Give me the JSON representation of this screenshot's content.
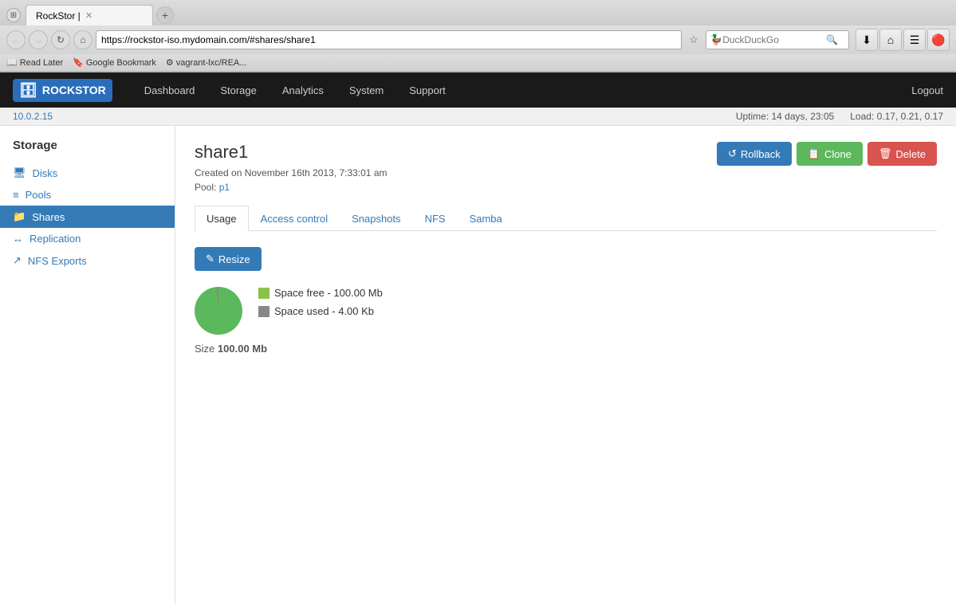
{
  "browser": {
    "tab_title": "RockStor |",
    "url": "https://rockstor-iso.mydomain.com/#shares/share1",
    "bookmarks": [
      {
        "label": "Read Later",
        "icon": "📖"
      },
      {
        "label": "Google Bookmark",
        "icon": "🔖"
      },
      {
        "label": "vagrant-lxc/REA...",
        "icon": "⚙"
      }
    ]
  },
  "app": {
    "logo": "ROCKSTOR",
    "nav": [
      "Dashboard",
      "Storage",
      "Analytics",
      "System",
      "Support"
    ],
    "logout": "Logout"
  },
  "status_bar": {
    "ip": "10.0.2.15",
    "uptime": "Uptime: 14 days, 23:05",
    "load": "Load: 0.17, 0.21, 0.17"
  },
  "sidebar": {
    "title": "Storage",
    "items": [
      {
        "label": "Disks",
        "icon": "🖥"
      },
      {
        "label": "Pools",
        "icon": "≡"
      },
      {
        "label": "Shares",
        "icon": "📁"
      },
      {
        "label": "Replication",
        "icon": "↔"
      },
      {
        "label": "NFS Exports",
        "icon": "↗"
      }
    ]
  },
  "share": {
    "title": "share1",
    "created": "Created on November 16th 2013, 7:33:01 am",
    "pool_label": "Pool:",
    "pool_link": "p1",
    "buttons": {
      "rollback": "Rollback",
      "clone": "Clone",
      "delete": "Delete"
    },
    "tabs": [
      "Usage",
      "Access control",
      "Snapshots",
      "NFS",
      "Samba"
    ],
    "active_tab": "Usage",
    "resize_btn": "Resize",
    "legend": {
      "free_label": "Space free - 100.00 Mb",
      "used_label": "Space used - 4.00 Kb"
    },
    "size_label": "Size",
    "size_value": "100.00 Mb"
  }
}
